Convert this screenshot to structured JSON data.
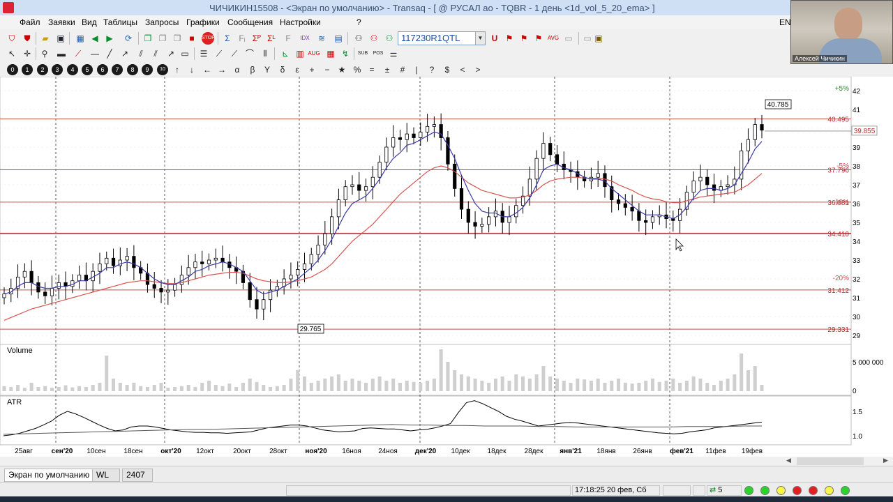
{
  "window": {
    "title": "ЧИЧИКИН15508 - <Экран по умолчанию> - Transaq - [ @ РУСАЛ ао - TQBR - 1 день <1d_vol_5_20_ema> ]",
    "language": "EN"
  },
  "menu": [
    "Файл",
    "Заявки",
    "Вид",
    "Таблицы",
    "Запросы",
    "Графики",
    "Сообщения",
    "Настройки",
    "?"
  ],
  "toolbar": {
    "security_code": "117230R1QTL"
  },
  "toolbar3_icons": [
    "circle-0",
    "circle-1",
    "circle-2",
    "circle-3",
    "circle-4",
    "circle-5",
    "circle-6",
    "circle-7",
    "circle-8",
    "circle-9",
    "circle-10",
    "arrow-up",
    "arrow-down",
    "arrow-left",
    "arrow-right",
    "alpha",
    "beta",
    "gamma",
    "delta",
    "epsilon",
    "plus",
    "minus",
    "star",
    "percent",
    "equals",
    "plus-minus",
    "pipe",
    "hash",
    "question",
    "dollar",
    "chevron-left",
    "chevron-right"
  ],
  "toolbar3_glyphs": [
    "0",
    "1",
    "2",
    "3",
    "4",
    "5",
    "6",
    "7",
    "8",
    "9",
    "10",
    "↑",
    "↓",
    "←",
    "→",
    "α",
    "β",
    "Y",
    "δ",
    "ε",
    "+",
    "−",
    "★",
    "%",
    "=",
    "±",
    "|",
    "#",
    "?",
    "$",
    "<",
    ">"
  ],
  "chart_data": {
    "type": "candlestick",
    "price_levels": [
      29.331,
      31.412,
      34.41,
      36.081,
      37.796,
      40.495
    ],
    "level_labels": [
      "29.331",
      "31.412",
      "34.410",
      "36.081",
      "37.796",
      "40.495"
    ],
    "pct_labels": [
      "+5%",
      "-5%",
      "-10%",
      "-20%"
    ],
    "last_price": "39.855",
    "annotations": {
      "high": "40.785",
      "low": "29.765"
    },
    "price_ticks": [
      "29",
      "30",
      "31",
      "32",
      "33",
      "34",
      "35",
      "36",
      "37",
      "38",
      "39",
      "40",
      "41",
      "42"
    ],
    "date_labels": [
      "25авг",
      "сен'20",
      "10сен",
      "18сен",
      "окт'20",
      "12окт",
      "20окт",
      "28окт",
      "ноя'20",
      "16ноя",
      "24ноя",
      "дек'20",
      "10дек",
      "18дек",
      "28дек",
      "янв'21",
      "18янв",
      "26янв",
      "фев'21",
      "11фев",
      "19фев"
    ],
    "volume_label": "Volume",
    "volume_ticks": [
      "5 000 000",
      "0"
    ],
    "atr_label": "ATR",
    "atr_ticks": [
      "1.5",
      "1.0"
    ],
    "closes": [
      31.2,
      31.5,
      32.1,
      32.4,
      31.8,
      31.3,
      31.1,
      31.5,
      31.8,
      31.6,
      31.9,
      32.2,
      31.9,
      32.4,
      32.8,
      33.1,
      32.7,
      33.0,
      33.2,
      32.6,
      32.3,
      31.7,
      31.5,
      31.3,
      31.4,
      31.7,
      32.2,
      32.6,
      32.9,
      32.8,
      33.0,
      33.1,
      32.9,
      32.6,
      32.4,
      31.8,
      30.9,
      30.4,
      30.9,
      31.4,
      31.6,
      32.0,
      32.2,
      32.5,
      32.8,
      33.3,
      33.8,
      34.4,
      35.3,
      36.2,
      36.9,
      37.0,
      36.7,
      36.9,
      37.4,
      38.2,
      39.0,
      39.5,
      39.4,
      39.7,
      39.5,
      39.8,
      40.1,
      40.2,
      39.5,
      38.1,
      36.8,
      35.7,
      35.0,
      34.8,
      34.9,
      35.3,
      35.6,
      35.0,
      35.3,
      35.9,
      36.4,
      37.3,
      38.4,
      39.2,
      38.6,
      38.1,
      37.8,
      37.7,
      37.4,
      37.2,
      37.4,
      37.6,
      36.9,
      36.2,
      36.0,
      35.8,
      35.6,
      35.1,
      35.0,
      35.3,
      35.4,
      35.2,
      35.1,
      35.7,
      36.6,
      37.2,
      37.4,
      37.0,
      36.7,
      36.9,
      37.0,
      37.3,
      38.8,
      39.4,
      40.2,
      39.9
    ],
    "ema5": [
      31.2,
      31.3,
      31.6,
      31.8,
      31.8,
      31.6,
      31.5,
      31.5,
      31.6,
      31.6,
      31.7,
      31.9,
      31.9,
      32.1,
      32.3,
      32.6,
      32.6,
      32.8,
      32.9,
      32.8,
      32.6,
      32.3,
      32.0,
      31.8,
      31.7,
      31.7,
      31.9,
      32.1,
      32.4,
      32.5,
      32.7,
      32.8,
      32.9,
      32.8,
      32.6,
      32.4,
      31.9,
      31.4,
      31.2,
      31.3,
      31.4,
      31.6,
      31.8,
      32.0,
      32.3,
      32.6,
      33.0,
      33.5,
      34.1,
      34.8,
      35.5,
      36.0,
      36.2,
      36.4,
      36.8,
      37.3,
      37.9,
      38.4,
      38.7,
      39.1,
      39.2,
      39.4,
      39.6,
      39.8,
      39.7,
      39.1,
      38.4,
      37.5,
      36.7,
      36.0,
      35.6,
      35.5,
      35.5,
      35.3,
      35.3,
      35.5,
      35.8,
      36.3,
      37.0,
      37.8,
      38.0,
      38.1,
      37.9,
      37.8,
      37.6,
      37.4,
      37.3,
      37.3,
      37.2,
      36.8,
      36.5,
      36.2,
      35.9,
      35.6,
      35.4,
      35.4,
      35.4,
      35.3,
      35.2,
      35.4,
      35.8,
      36.3,
      36.7,
      36.8,
      36.8,
      36.7,
      36.8,
      37.0,
      37.6,
      38.2,
      38.9,
      39.3
    ],
    "ema20": [
      29.8,
      29.95,
      30.1,
      30.25,
      30.4,
      30.5,
      30.6,
      30.7,
      30.8,
      30.9,
      31.0,
      31.1,
      31.2,
      31.3,
      31.4,
      31.5,
      31.6,
      31.7,
      31.8,
      31.85,
      31.9,
      31.9,
      31.85,
      31.8,
      31.75,
      31.75,
      31.8,
      31.9,
      32.0,
      32.1,
      32.2,
      32.25,
      32.3,
      32.35,
      32.35,
      32.3,
      32.15,
      32.0,
      31.9,
      31.85,
      31.8,
      31.8,
      31.85,
      31.9,
      32.0,
      32.1,
      32.3,
      32.5,
      32.8,
      33.2,
      33.6,
      34.0,
      34.3,
      34.6,
      34.9,
      35.3,
      35.7,
      36.1,
      36.5,
      36.8,
      37.1,
      37.4,
      37.7,
      37.9,
      38.0,
      37.9,
      37.7,
      37.4,
      37.1,
      36.9,
      36.7,
      36.6,
      36.5,
      36.4,
      36.3,
      36.3,
      36.35,
      36.45,
      36.7,
      37.0,
      37.2,
      37.3,
      37.35,
      37.4,
      37.4,
      37.35,
      37.35,
      37.35,
      37.3,
      37.2,
      37.0,
      36.85,
      36.7,
      36.5,
      36.35,
      36.25,
      36.2,
      36.1,
      36.05,
      36.05,
      36.15,
      36.25,
      36.35,
      36.4,
      36.45,
      36.5,
      36.55,
      36.6,
      36.8,
      37.0,
      37.3,
      37.6
    ],
    "volume_fraction": [
      0.12,
      0.1,
      0.15,
      0.08,
      0.2,
      0.1,
      0.12,
      0.08,
      0.1,
      0.14,
      0.09,
      0.12,
      0.1,
      0.15,
      0.2,
      0.85,
      0.3,
      0.2,
      0.15,
      0.2,
      0.12,
      0.1,
      0.15,
      0.2,
      0.08,
      0.1,
      0.12,
      0.15,
      0.1,
      0.2,
      0.25,
      0.15,
      0.12,
      0.18,
      0.1,
      0.2,
      0.3,
      0.22,
      0.15,
      0.1,
      0.12,
      0.15,
      0.3,
      0.5,
      0.35,
      0.2,
      0.25,
      0.3,
      0.35,
      0.4,
      0.25,
      0.3,
      0.25,
      0.2,
      0.3,
      0.35,
      0.25,
      0.3,
      0.2,
      0.25,
      0.22,
      0.2,
      0.25,
      0.3,
      1.0,
      0.7,
      0.5,
      0.4,
      0.35,
      0.3,
      0.25,
      0.2,
      0.3,
      0.35,
      0.25,
      0.4,
      0.35,
      0.3,
      0.4,
      0.6,
      0.35,
      0.3,
      0.25,
      0.2,
      0.3,
      0.28,
      0.25,
      0.3,
      0.2,
      0.25,
      0.3,
      0.2,
      0.18,
      0.2,
      0.25,
      0.3,
      0.22,
      0.25,
      0.3,
      0.2,
      0.25,
      0.35,
      0.3,
      0.2,
      0.15,
      0.25,
      0.3,
      0.4,
      0.9,
      0.5,
      0.6,
      0.15
    ],
    "atr_values": [
      1.0,
      1.02,
      1.05,
      1.1,
      1.15,
      1.22,
      1.3,
      1.42,
      1.5,
      1.45,
      1.38,
      1.3,
      1.22,
      1.15,
      1.1,
      1.12,
      1.18,
      1.2,
      1.2,
      1.18,
      1.15,
      1.12,
      1.1,
      1.08,
      1.07,
      1.07,
      1.06,
      1.06,
      1.05,
      1.06,
      1.07,
      1.08,
      1.12,
      1.16,
      1.18,
      1.2,
      1.22,
      1.22,
      1.2,
      1.16,
      1.12,
      1.1,
      1.08,
      1.09,
      1.1,
      1.15,
      1.16,
      1.15,
      1.14,
      1.14,
      1.12,
      1.1,
      1.12,
      1.13,
      1.16,
      1.2,
      1.25,
      1.48,
      1.68,
      1.72,
      1.66,
      1.58,
      1.5,
      1.4,
      1.34,
      1.3,
      1.25,
      1.2,
      1.22,
      1.24,
      1.26,
      1.27,
      1.26,
      1.24,
      1.22,
      1.2,
      1.18,
      1.16,
      1.14,
      1.12,
      1.1,
      1.08,
      1.06,
      1.05,
      1.04,
      1.05,
      1.08,
      1.1,
      1.12,
      1.16,
      1.18,
      1.2,
      1.22,
      1.24,
      1.26,
      1.28
    ],
    "atr_ma": [
      1.03,
      1.04,
      1.05,
      1.06,
      1.07,
      1.08,
      1.09,
      1.1,
      1.11,
      1.12,
      1.13,
      1.13,
      1.14,
      1.15,
      1.16,
      1.17,
      1.18,
      1.19,
      1.2,
      1.21,
      1.22,
      1.23,
      1.22,
      1.22,
      1.21,
      1.21,
      1.2,
      1.2,
      1.2,
      1.19,
      1.19,
      1.18,
      1.18,
      1.18,
      1.18,
      1.18,
      1.18,
      1.19,
      1.19,
      1.19,
      1.2,
      1.2
    ]
  },
  "tabs": [
    "Экран по умолчанию",
    "WL",
    "2407"
  ],
  "status": {
    "datetime": "17:18:25  20 фев, Сб",
    "connections": "5"
  },
  "status_lights": [
    "#2ad42a",
    "#2ad42a",
    "#f5f54a",
    "#e32020",
    "#e32020",
    "#f5f54a",
    "#2ad42a"
  ],
  "webcam": {
    "caption": "Алексей Чичикин"
  }
}
